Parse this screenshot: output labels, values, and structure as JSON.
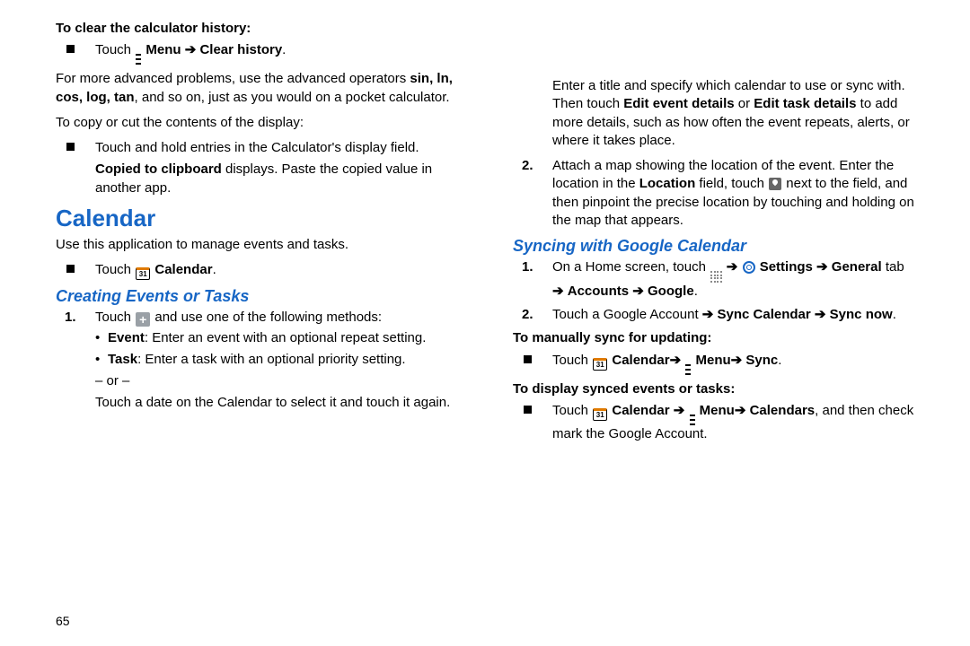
{
  "pageNumber": "65",
  "arrow": "➔",
  "left": {
    "clearCalcHeading": "To clear the calculator history:",
    "clearCalcTouch": "Touch",
    "clearCalcMenu": "Menu",
    "clearCalcClear": "Clear history",
    "clearCalcPeriod": ".",
    "advancedText1": "For more advanced problems, use the advanced operators ",
    "advancedOps": "sin, ln, cos, log, tan",
    "advancedText2": ", and so on, just as you would on a pocket calculator.",
    "copyCutIntro": "To copy or cut the contents of the display:",
    "copyCutStep": "Touch and hold entries in the Calculator's display field.",
    "copiedBold": "Copied to clipboard",
    "copiedRest": " displays. Paste the copied value in another app.",
    "calendarHeading": "Calendar",
    "calendarIntro": "Use this application to manage events and tasks.",
    "touchCalTouch": "Touch",
    "calendarWord": "Calendar",
    "period": ".",
    "cal31": "31",
    "creatingHeading": "Creating Events or Tasks",
    "step1Touch": "Touch",
    "step1Rest": " and use one of the following methods:",
    "eventBold": "Event",
    "eventRest": ": Enter an event with an optional repeat setting.",
    "taskBold": "Task",
    "taskRest": ": Enter a task with an optional priority setting.",
    "orLine": "– or –",
    "afterOr": "Touch a date on the Calendar to select it and touch it again."
  },
  "right": {
    "enterTitle1": "Enter a title and specify which calendar to use or sync with. Then touch ",
    "editEvent": "Edit event details",
    "orWord": " or ",
    "editTask": "Edit task details",
    "enterTitle2": " to add more details, such as how often the event repeats, alerts, or where it takes place.",
    "step2a": "Attach a map showing the location of the event. Enter the location in the ",
    "locationBold": "Location",
    "step2b": " field, touch ",
    "step2c": " next to the field, and then pinpoint the precise location by touching and holding on the map that appears.",
    "syncHeading": "Syncing with Google Calendar",
    "sync1a": "On a Home screen, touch ",
    "settingsWord": "Settings",
    "generalTab": "General",
    "tabWord": " tab ",
    "accounts": "Accounts",
    "google": "Google",
    "sync2a": "Touch a Google Account ",
    "syncCalendar": "Sync Calendar",
    "syncNow": "Sync now",
    "manualSyncHeading": "To manually sync for updating:",
    "manualTouch": "Touch",
    "calendarWord2": "Calendar",
    "menuWord": "Menu",
    "syncWord": "Sync",
    "displayHeading": "To display synced events or tasks:",
    "calendarsWord": "Calendars",
    "displayTail": ", and then check mark the Google Account."
  }
}
